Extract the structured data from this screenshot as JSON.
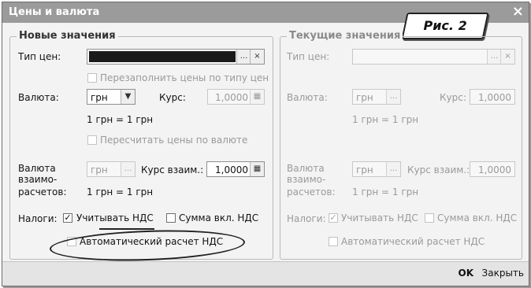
{
  "window": {
    "title": "Цены и валюта",
    "close_glyph": "×"
  },
  "figure_label": "Рис. 2",
  "new_values": {
    "group_title": "Новые значения",
    "price_type_label": "Тип цен:",
    "refill_prices_label": "Перезаполнить цены по типу цен",
    "currency_label": "Валюта:",
    "currency_value": "грн",
    "rate_label": "Курс:",
    "rate_value": "1,0000",
    "currency_note": "1 грн = 1 грн",
    "recalc_label": "Пересчитать цены по валюте",
    "settle_currency_label": [
      "Валюта",
      "взаимо-",
      "расчетов:"
    ],
    "settle_currency_value": "грн",
    "settle_rate_label": "Курс взаим.:",
    "settle_rate_value": "1,0000",
    "settle_note": "1 грн = 1 грн",
    "taxes_label": "Налоги:",
    "include_vat_label": "Учитывать НДС",
    "include_vat_checked": true,
    "sum_incl_vat_label": "Сумма вкл. НДС",
    "auto_vat_label": "Автоматический расчет НДС"
  },
  "current_values": {
    "group_title": "Текущие значения",
    "price_type_label": "Тип цен:",
    "currency_label": "Валюта:",
    "currency_value": "грн",
    "rate_label": "Курс:",
    "rate_value": "1,0000",
    "currency_note": "1 грн = 1 грн",
    "settle_currency_label": [
      "Валюта",
      "взаимо-",
      "расчетов:"
    ],
    "settle_currency_value": "грн",
    "settle_rate_label": "Курс взаим.:",
    "settle_rate_value": "1,0000",
    "settle_note": "1 грн = 1 грн",
    "taxes_label": "Налоги:",
    "include_vat_label": "Учитывать НДС",
    "include_vat_checked": true,
    "sum_incl_vat_label": "Сумма вкл. НДС",
    "auto_vat_label": "Автоматический расчет НДС"
  },
  "glyphs": {
    "ellipsis": "...",
    "clear": "×",
    "dropdown": "▼",
    "calc": "▦",
    "check": "✓"
  },
  "footer": {
    "ok_label": "OK",
    "close_label": "Закрыть"
  }
}
